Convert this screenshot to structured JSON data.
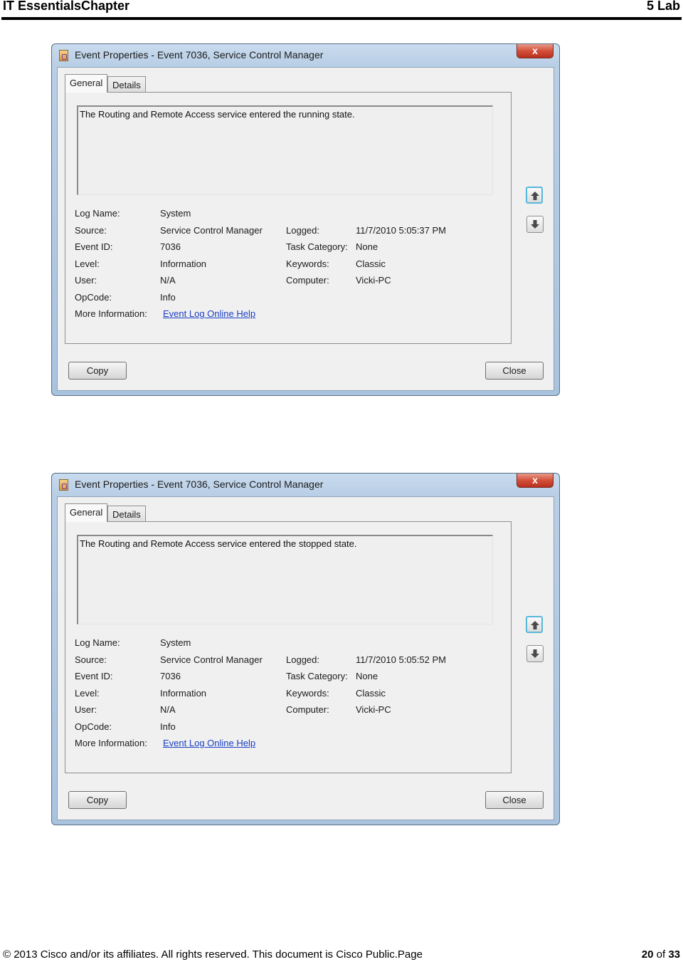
{
  "document": {
    "header_left": "IT EssentialsChapter",
    "header_right": "5 Lab",
    "footer_left": "© 2013 Cisco and/or its affiliates. All rights reserved. This document is Cisco Public.Page",
    "footer_page_current": "20",
    "footer_page_of": " of ",
    "footer_page_total": "33"
  },
  "dialogs": [
    {
      "title": "Event Properties - Event 7036, Service Control Manager",
      "close_glyph": "x",
      "tabs": [
        {
          "label": "General",
          "active": true
        },
        {
          "label": "Details",
          "active": false
        }
      ],
      "description": "The Routing and Remote Access service entered the running state.",
      "labels": {
        "log_name": "Log Name:",
        "source": "Source:",
        "event_id": "Event ID:",
        "level": "Level:",
        "user": "User:",
        "opcode": "OpCode:",
        "more_info": "More Information:",
        "logged": "Logged:",
        "task_category": "Task Category:",
        "keywords": "Keywords:",
        "computer": "Computer:"
      },
      "values": {
        "log_name": "System",
        "source": "Service Control Manager",
        "event_id": "7036",
        "level": "Information",
        "user": "N/A",
        "opcode": "Info",
        "more_info_link": "Event Log Online Help",
        "logged": "11/7/2010 5:05:37 PM",
        "task_category": "None",
        "keywords": "Classic",
        "computer": "Vicki-PC"
      },
      "buttons": {
        "copy": "Copy",
        "close": "Close"
      }
    },
    {
      "title": "Event Properties - Event 7036, Service Control Manager",
      "close_glyph": "x",
      "tabs": [
        {
          "label": "General",
          "active": true
        },
        {
          "label": "Details",
          "active": false
        }
      ],
      "description": "The Routing and Remote Access service entered the stopped state.",
      "labels": {
        "log_name": "Log Name:",
        "source": "Source:",
        "event_id": "Event ID:",
        "level": "Level:",
        "user": "User:",
        "opcode": "OpCode:",
        "more_info": "More Information:",
        "logged": "Logged:",
        "task_category": "Task Category:",
        "keywords": "Keywords:",
        "computer": "Computer:"
      },
      "values": {
        "log_name": "System",
        "source": "Service Control Manager",
        "event_id": "7036",
        "level": "Information",
        "user": "N/A",
        "opcode": "Info",
        "more_info_link": "Event Log Online Help",
        "logged": "11/7/2010 5:05:52 PM",
        "task_category": "None",
        "keywords": "Classic",
        "computer": "Vicki-PC"
      },
      "buttons": {
        "copy": "Copy",
        "close": "Close"
      }
    }
  ]
}
